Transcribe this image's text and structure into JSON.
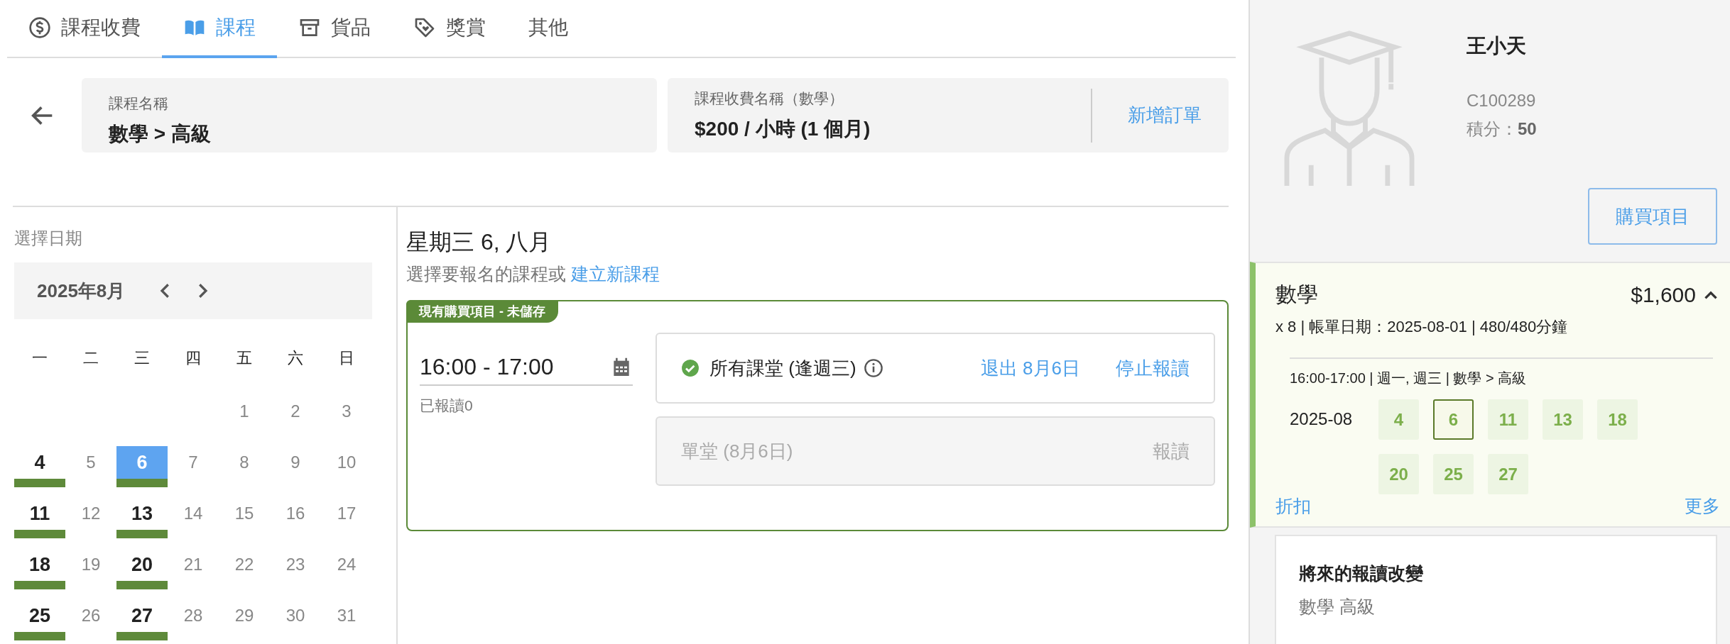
{
  "tabs": [
    {
      "label": "課程收費",
      "selected": false
    },
    {
      "label": "課程",
      "selected": true
    },
    {
      "label": "貨品",
      "selected": false
    },
    {
      "label": "獎賞",
      "selected": false
    },
    {
      "label": "其他",
      "selected": false
    }
  ],
  "course_card": {
    "label": "課程名稱",
    "value": "數學 > 高級"
  },
  "fee_card": {
    "label": "課程收費名稱（數學）",
    "value": "$200 / 小時 (1 個月)",
    "action": "新增訂單"
  },
  "calendar": {
    "title": "選擇日期",
    "month": "2025年8月",
    "weekdays": [
      "一",
      "二",
      "三",
      "四",
      "五",
      "六",
      "日"
    ],
    "weeks": [
      [
        {
          "day": "1",
          "scheduled": false,
          "selected": false
        },
        {
          "day": "2",
          "scheduled": false,
          "selected": false
        },
        {
          "day": "3",
          "scheduled": false,
          "selected": false
        }
      ],
      [
        {
          "day": "4",
          "scheduled": true,
          "selected": false
        },
        {
          "day": "5",
          "scheduled": false,
          "selected": false
        },
        {
          "day": "6",
          "scheduled": true,
          "selected": true
        },
        {
          "day": "7",
          "scheduled": false,
          "selected": false
        },
        {
          "day": "8",
          "scheduled": false,
          "selected": false
        },
        {
          "day": "9",
          "scheduled": false,
          "selected": false
        },
        {
          "day": "10",
          "scheduled": false,
          "selected": false
        }
      ],
      [
        {
          "day": "11",
          "scheduled": true,
          "selected": false
        },
        {
          "day": "12",
          "scheduled": false,
          "selected": false
        },
        {
          "day": "13",
          "scheduled": true,
          "selected": false
        },
        {
          "day": "14",
          "scheduled": false,
          "selected": false
        },
        {
          "day": "15",
          "scheduled": false,
          "selected": false
        },
        {
          "day": "16",
          "scheduled": false,
          "selected": false
        },
        {
          "day": "17",
          "scheduled": false,
          "selected": false
        }
      ],
      [
        {
          "day": "18",
          "scheduled": true,
          "selected": false
        },
        {
          "day": "19",
          "scheduled": false,
          "selected": false
        },
        {
          "day": "20",
          "scheduled": true,
          "selected": false
        },
        {
          "day": "21",
          "scheduled": false,
          "selected": false
        },
        {
          "day": "22",
          "scheduled": false,
          "selected": false
        },
        {
          "day": "23",
          "scheduled": false,
          "selected": false
        },
        {
          "day": "24",
          "scheduled": false,
          "selected": false
        }
      ],
      [
        {
          "day": "25",
          "scheduled": true,
          "selected": false
        },
        {
          "day": "26",
          "scheduled": false,
          "selected": false
        },
        {
          "day": "27",
          "scheduled": true,
          "selected": false
        },
        {
          "day": "28",
          "scheduled": false,
          "selected": false
        },
        {
          "day": "29",
          "scheduled": false,
          "selected": false
        },
        {
          "day": "30",
          "scheduled": false,
          "selected": false
        },
        {
          "day": "31",
          "scheduled": false,
          "selected": false
        }
      ]
    ]
  },
  "day_panel": {
    "title": "星期三 6, 八月",
    "hint": "選擇要報名的課程或",
    "hint_link": "建立新課程",
    "slot": {
      "tag": "現有購買項目 - 未儲存",
      "time": "16:00 - 17:00",
      "enrolled": "已報讀0",
      "options": [
        {
          "label": "所有課堂 (逢週三)",
          "selected": true,
          "actions": [
            "退出 8月6日",
            "停止報讀"
          ]
        },
        {
          "label": "單堂 (8月6日)",
          "selected": false,
          "actions": [
            "報讀"
          ]
        }
      ]
    }
  },
  "customer": {
    "name": "王小天",
    "id": "C100289",
    "points_label": "積分：",
    "points": "50",
    "button": "購買項目"
  },
  "purchase": {
    "title": "數學",
    "price": "$1,600",
    "expanded": true,
    "details": "x 8 | 帳單日期：2025-08-01 | 480/480分鐘",
    "schedule": "16:00-17:00 | 週一, 週三 | 數學 > 高級",
    "month": "2025-08",
    "sessions": [
      {
        "day": "4",
        "selected": false
      },
      {
        "day": "6",
        "selected": true
      },
      {
        "day": "11",
        "selected": false
      },
      {
        "day": "13",
        "selected": false
      },
      {
        "day": "18",
        "selected": false
      },
      {
        "day": "20",
        "selected": false
      },
      {
        "day": "25",
        "selected": false
      },
      {
        "day": "27",
        "selected": false
      }
    ],
    "links": [
      "折扣",
      "更多"
    ]
  },
  "future_changes": {
    "title": "將來的報讀改變",
    "item": "數學 高級"
  }
}
